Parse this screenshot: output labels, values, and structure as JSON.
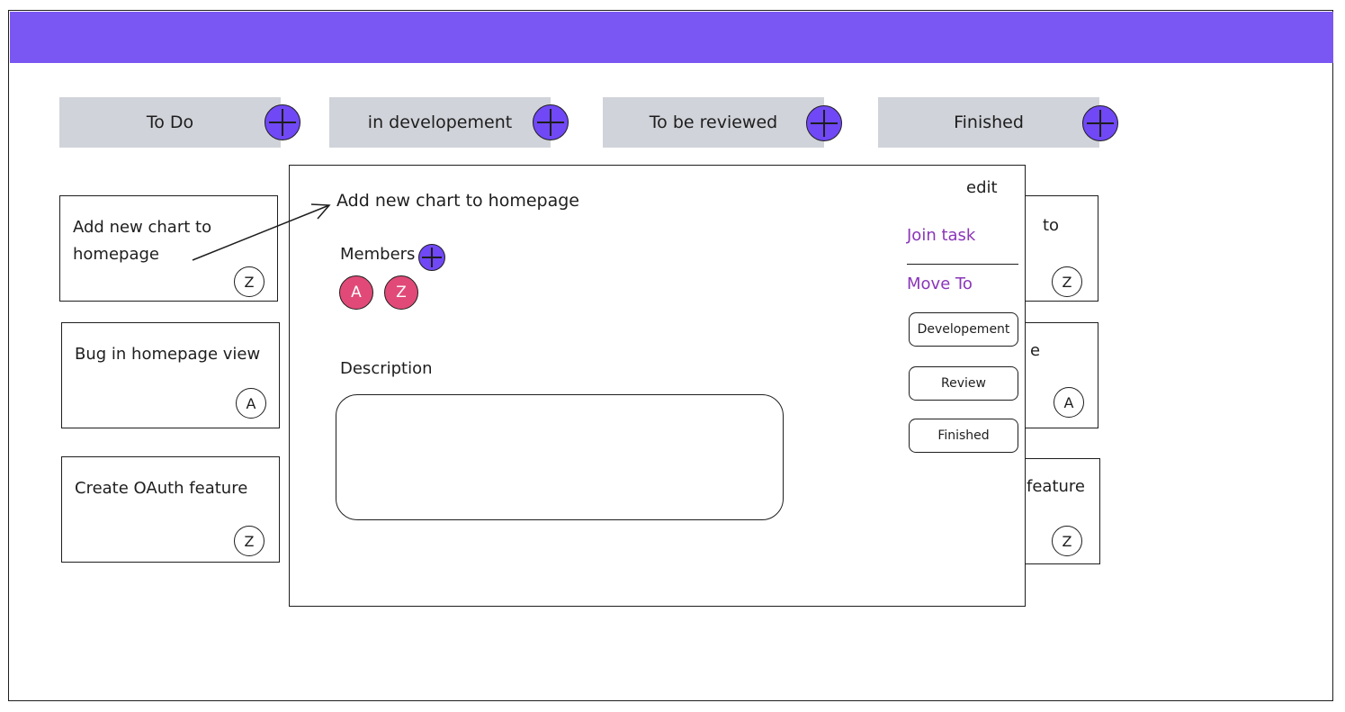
{
  "colors": {
    "header_bar": "#7a57f2",
    "plus_button": "#7048f5",
    "column_header_bg": "#d0d3d9",
    "avatar_fill": "#e14a78",
    "accent_text": "#8a36b8"
  },
  "columns": [
    {
      "label": "To Do",
      "add_icon": "plus-circle-icon"
    },
    {
      "label": "in developement",
      "add_icon": "plus-circle-icon"
    },
    {
      "label": "To be reviewed",
      "add_icon": "plus-circle-icon"
    },
    {
      "label": "Finished",
      "add_icon": "plus-circle-icon"
    }
  ],
  "todo_cards": [
    {
      "title": "Add new chart to homepage",
      "assignee": "Z"
    },
    {
      "title": "Bug in homepage view",
      "assignee": "A"
    },
    {
      "title": "Create OAuth feature",
      "assignee": "Z"
    }
  ],
  "right_cards": [
    {
      "title_fragment": "to",
      "assignee": "Z"
    },
    {
      "title_fragment": "e",
      "assignee": "A"
    },
    {
      "title_fragment": "feature",
      "assignee": "Z"
    }
  ],
  "modal": {
    "title": "Add new chart to homepage",
    "edit_label": "edit",
    "members_label": "Members",
    "members": [
      "A",
      "Z"
    ],
    "description_label": "Description",
    "description_value": "",
    "join_label": "Join task",
    "move_to_label": "Move To",
    "move_options": [
      "Developement",
      "Review",
      "Finished"
    ]
  }
}
